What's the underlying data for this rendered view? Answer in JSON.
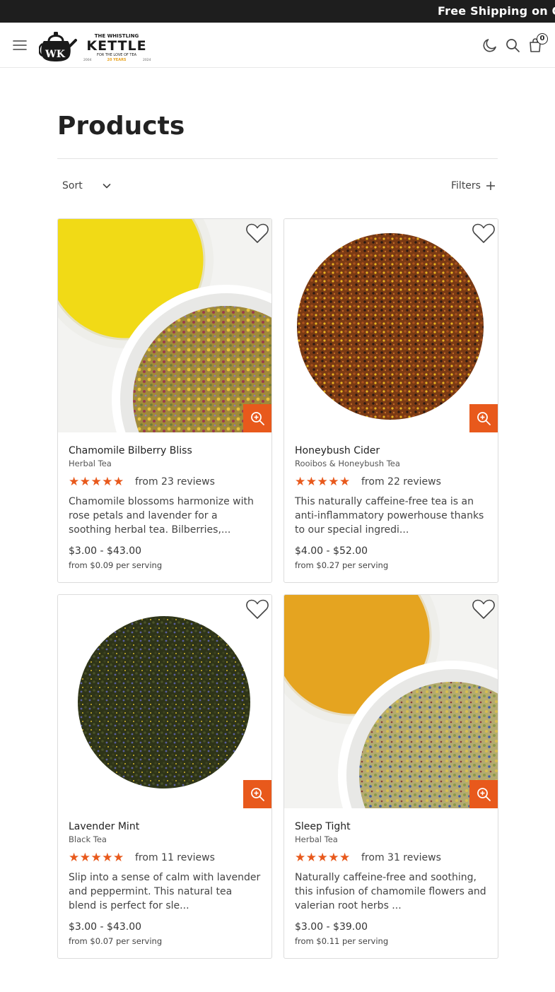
{
  "announcement": "Free Shipping on O",
  "header": {
    "logo": {
      "text_top": "THE WHISTLING",
      "text_main": "KETTLE",
      "tagline": "FOR THE LOVE OF TEA",
      "year_start": "2004",
      "anniversary": "20 YEARS",
      "year_end": "2024",
      "monogram": "WK"
    },
    "menu_icon": "hamburger-icon",
    "dark_mode_icon": "moon-icon",
    "search_icon": "search-icon",
    "cart_icon": "shopping-bag-icon",
    "cart_count": "0"
  },
  "page": {
    "title": "Products",
    "sort_label": "Sort",
    "filters_label": "Filters"
  },
  "colors": {
    "accent": "#e8591c",
    "announcement_bg": "#1e1e1e"
  },
  "products": [
    {
      "name": "Chamomile Bilberry Bliss",
      "type": "Herbal Tea",
      "rating_stars": 5,
      "reviews": "from 23 reviews",
      "description": "Chamomile blossoms harmonize with rose petals and lavender for a soothing herbal tea. Bilberries,...",
      "price": "$3.00 - $43.00",
      "per_serving": "from $0.09 per serving",
      "image": "chamomile-bilberry-tea-photo"
    },
    {
      "name": "Honeybush Cider",
      "type": "Rooibos & Honeybush Tea",
      "rating_stars": 5,
      "reviews": "from 22 reviews",
      "description": "This naturally caffeine-free tea is an anti-inflammatory powerhouse thanks to our special ingredi...",
      "price": "$4.00 - $52.00",
      "per_serving": "from $0.27 per serving",
      "image": "honeybush-cider-tea-photo"
    },
    {
      "name": "Lavender Mint",
      "type": "Black Tea",
      "rating_stars": 5,
      "reviews": "from 11 reviews",
      "description": "Slip into a sense of calm with lavender and peppermint. This natural tea blend is perfect for sle...",
      "price": "$3.00 - $43.00",
      "per_serving": "from $0.07 per serving",
      "image": "lavender-mint-tea-photo"
    },
    {
      "name": "Sleep Tight",
      "type": "Herbal Tea",
      "rating_stars": 5,
      "reviews": "from 31 reviews",
      "description": "Naturally caffeine-free and soothing, this infusion of chamomile flowers and valerian root herbs ...",
      "price": "$3.00 - $39.00",
      "per_serving": "from $0.11 per serving",
      "image": "sleep-tight-tea-photo"
    }
  ]
}
